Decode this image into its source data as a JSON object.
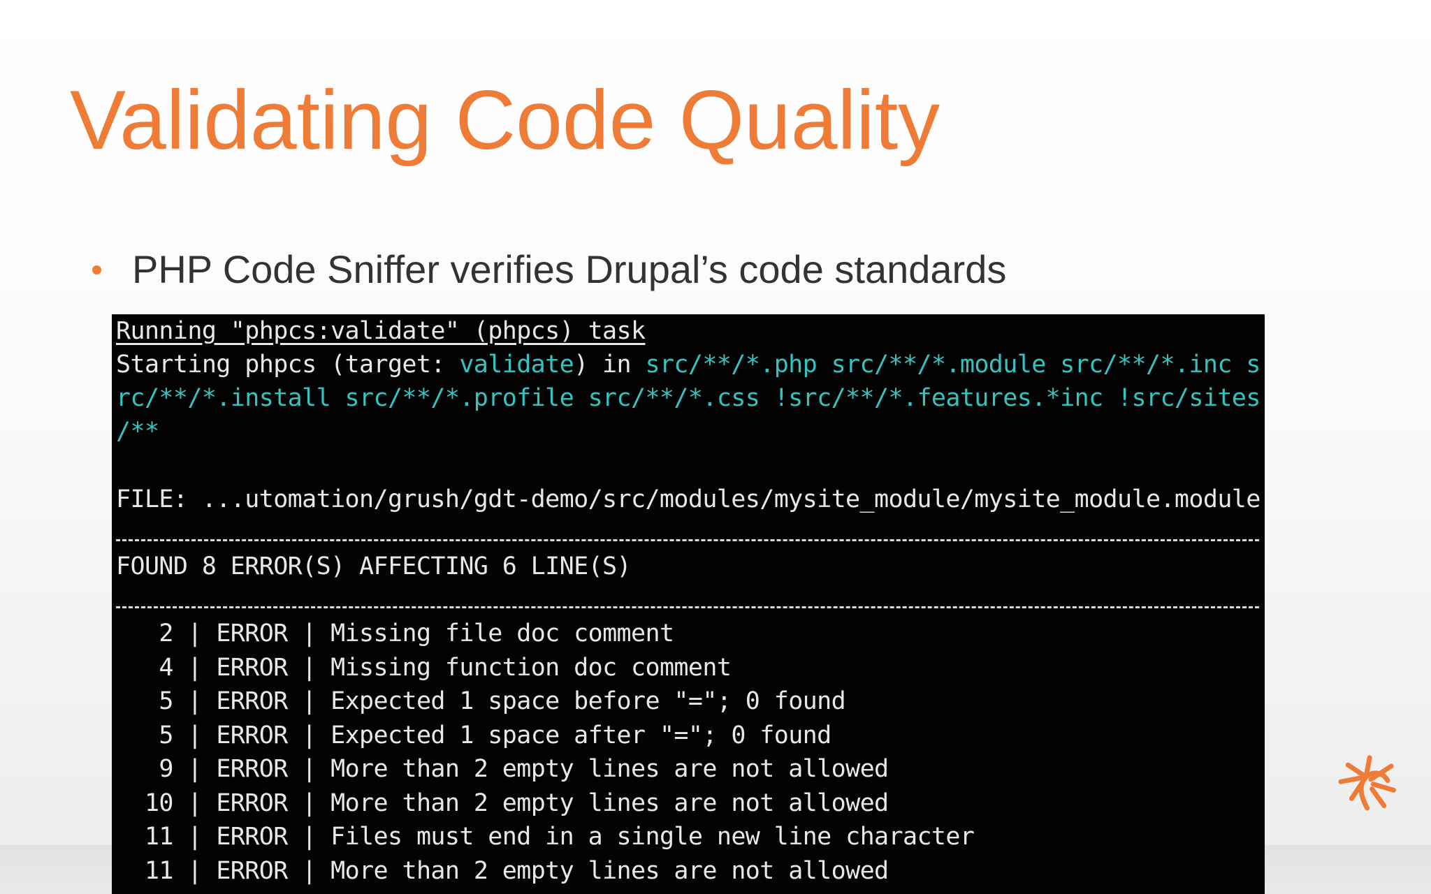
{
  "slide": {
    "title": "Validating Code Quality",
    "bullet": "PHP Code Sniffer verifies Drupal’s code standards"
  },
  "terminal": {
    "task_line": "Running \"phpcs:validate\" (phpcs) task",
    "start_prefix": "Starting phpcs (target: ",
    "start_target": "validate",
    "start_mid": ") in ",
    "start_paths_1": "src/**/*.php src/**/*.module src/**/*.inc s",
    "start_paths_2": "rc/**/*.install src/**/*.profile src/**/*.css !src/**/*.features.*inc !src/sites",
    "start_paths_3": "/**",
    "file_line": "FILE: ...utomation/grush/gdt-demo/src/modules/mysite_module/mysite_module.module",
    "found_line": "FOUND 8 ERROR(S) AFFECTING 6 LINE(S)",
    "errors": [
      {
        "line": " 2",
        "type": "ERROR",
        "message": "Missing file doc comment"
      },
      {
        "line": " 4",
        "type": "ERROR",
        "message": "Missing function doc comment"
      },
      {
        "line": " 5",
        "type": "ERROR",
        "message": "Expected 1 space before \"=\"; 0 found"
      },
      {
        "line": " 5",
        "type": "ERROR",
        "message": "Expected 1 space after \"=\"; 0 found"
      },
      {
        "line": " 9",
        "type": "ERROR",
        "message": "More than 2 empty lines are not allowed"
      },
      {
        "line": "10",
        "type": "ERROR",
        "message": "More than 2 empty lines are not allowed"
      },
      {
        "line": "11",
        "type": "ERROR",
        "message": "Files must end in a single new line character"
      },
      {
        "line": "11",
        "type": "ERROR",
        "message": "More than 2 empty lines are not allowed"
      }
    ]
  },
  "colors": {
    "accent": "#ee7b36",
    "terminal_bg": "#030303",
    "terminal_text": "#e8e8e8",
    "terminal_cyan": "#37c2c2",
    "body_text": "#333333"
  },
  "icons": {
    "logo": "drupal-sunburst-logo-icon",
    "bullet": "bullet-dot-icon"
  }
}
